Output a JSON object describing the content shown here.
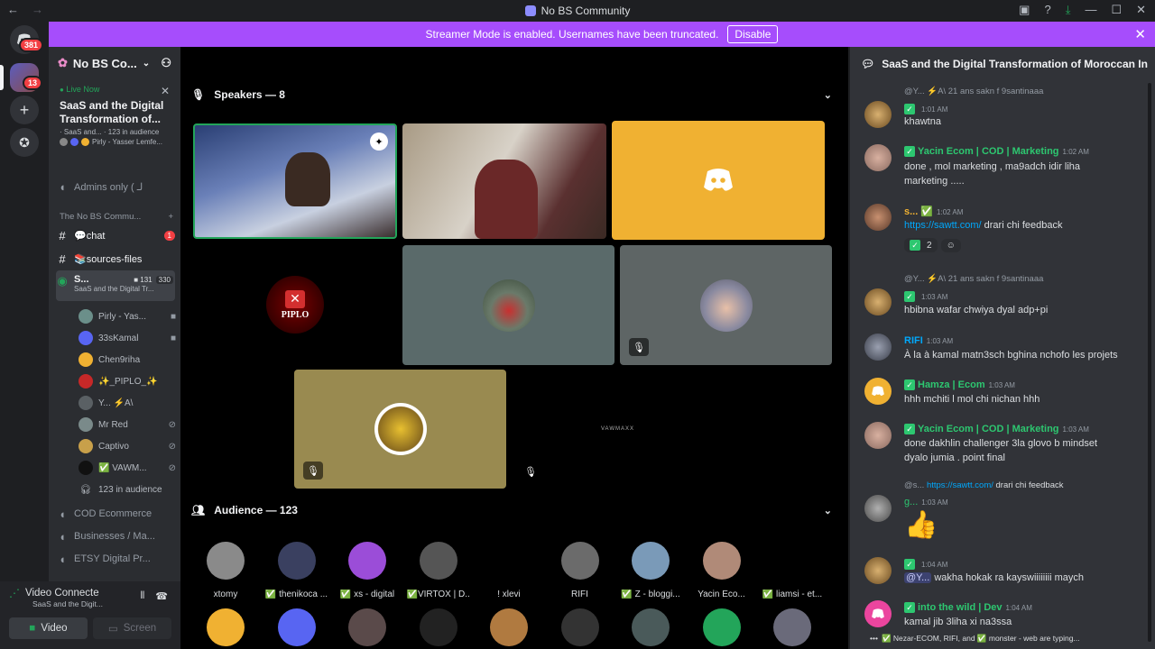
{
  "window": {
    "title": "No BS Community"
  },
  "banner": {
    "text": "Streamer Mode is enabled. Usernames have been truncated.",
    "button": "Disable"
  },
  "guilds": {
    "dm_badge": "381",
    "server_badge": "13"
  },
  "server": {
    "name": "No BS Co..."
  },
  "stage_info": {
    "live_label": "Live Now",
    "title_line1": "SaaS and the Digital",
    "title_line2": "Transformation of...",
    "subtitle": "· SaaS and... · 123 in audience",
    "speakers_preview": "Pirly - Yasser Lemfe..."
  },
  "channels": {
    "admins_only": "Admins only ( لـ",
    "category": "The No BS Commu...",
    "chat": "💬chat",
    "chat_badge": "1",
    "sources": "📚sources-files",
    "stage_channel": "S...",
    "stage_count_a": "131",
    "stage_count_b": "330",
    "stage_channel_sub": "SaaS and the Digital Tr...",
    "members": [
      {
        "name": "Pirly - Yas...",
        "color": "#6b8f8a"
      },
      {
        "name": "33sKamal",
        "color": "#5865f2"
      },
      {
        "name": "Chen9riha",
        "color": "#f0b132"
      },
      {
        "name": "✨_PIPLO_✨",
        "color": "#c62828"
      },
      {
        "name": "Y... ⚡A\\",
        "color": "#5a6064"
      },
      {
        "name": "Mr Red",
        "color": "#7a8a8a"
      },
      {
        "name": "Captivo",
        "color": "#c8a04a"
      },
      {
        "name": "✅ VAWM...",
        "color": "#111111"
      }
    ],
    "audience_row": "123 in audience",
    "cod": "COD Ecommerce",
    "business": "Businesses / Ma...",
    "etsy": "ETSY Digital Pr..."
  },
  "voice_panel": {
    "status": "Video Connecte",
    "sub": "SaaS and the Digit...",
    "video_btn": "Video",
    "screen_btn": "Screen"
  },
  "stage": {
    "speakers_header": "Speakers — 8",
    "audience_header": "Audience — 123",
    "audience": [
      {
        "name": "xtomy",
        "color": "#8a8a8a"
      },
      {
        "name": "✅ thenikoca ...",
        "color": "#3a4060"
      },
      {
        "name": "✅ xs - digital",
        "color": "#9b4dd8"
      },
      {
        "name": "✅VIRTOX | D...",
        "color": "#555555"
      },
      {
        "name": "! xlevi",
        "color": "#000000"
      },
      {
        "name": "RIFI",
        "color": "#6b6b6b"
      },
      {
        "name": "✅ Z - bloggi...",
        "color": "#7a9ab8"
      },
      {
        "name": "Yacin Eco...",
        "color": "#b08a78"
      },
      {
        "name": "✅ liamsi - et...",
        "color": "#000000"
      }
    ],
    "speaker_piplo_text": "PIPLO",
    "speaker_vawmaxx_text": "VAWMAXX",
    "colors": {
      "discord_orange": "#f0b132",
      "tile_gray": "#5a6a6a",
      "tile_khaki": "#998a50"
    }
  },
  "chat": {
    "title": "SaaS and the Digital Transformation of Moroccan In",
    "messages": [
      {
        "reply": "@Y... ⚡A\\  21 ans sakn f 9santinaaa",
        "time": "1:01 AM",
        "text": "khawtna"
      },
      {
        "author": "Yacin Ecom | COD | Marketing",
        "time": "1:02 AM",
        "text1": "done , mol marketing , ma9adch idir liha",
        "text2": "marketing ....."
      },
      {
        "author": "s... ✅",
        "time": "1:02 AM",
        "link": "https://sawtt.com/",
        "text": "drari chi feedback",
        "reaction_count": "2"
      },
      {
        "reply": "@Y... ⚡A\\  21 ans sakn f 9santinaaa",
        "time": "1:03 AM",
        "text": "hbibna wafar chwiya dyal adp+pi"
      },
      {
        "author": "RIFI",
        "time": "1:03 AM",
        "text": "À la à kamal matn3sch bghina nchofo les projets"
      },
      {
        "author": "Hamza | Ecom",
        "time": "1:03 AM",
        "text": "hhh mchiti l mol chi nichan hhh"
      },
      {
        "author": "Yacin Ecom | COD | Marketing",
        "time": "1:03 AM",
        "text1": "done dakhlin challenger 3la glovo b mindset",
        "text2": "dyalo jumia . point final"
      },
      {
        "reply_user": "@s...",
        "reply_link": "https://sawtt.com/",
        "reply_text": "drari chi feedback",
        "author": "g...",
        "time": "1:03 AM",
        "emoji": "👍"
      },
      {
        "time": "1:04 AM",
        "mention": "@Y...",
        "text": "wakha hokak ra kayswiiiiiiii maych"
      },
      {
        "author": "into the wild | Dev",
        "time": "1:04 AM",
        "text": "kamal jib 3liha xi na3ssa"
      }
    ],
    "typing": "✅ Nezar-ECOM, RIFI, and ✅ monster - web are typing..."
  }
}
